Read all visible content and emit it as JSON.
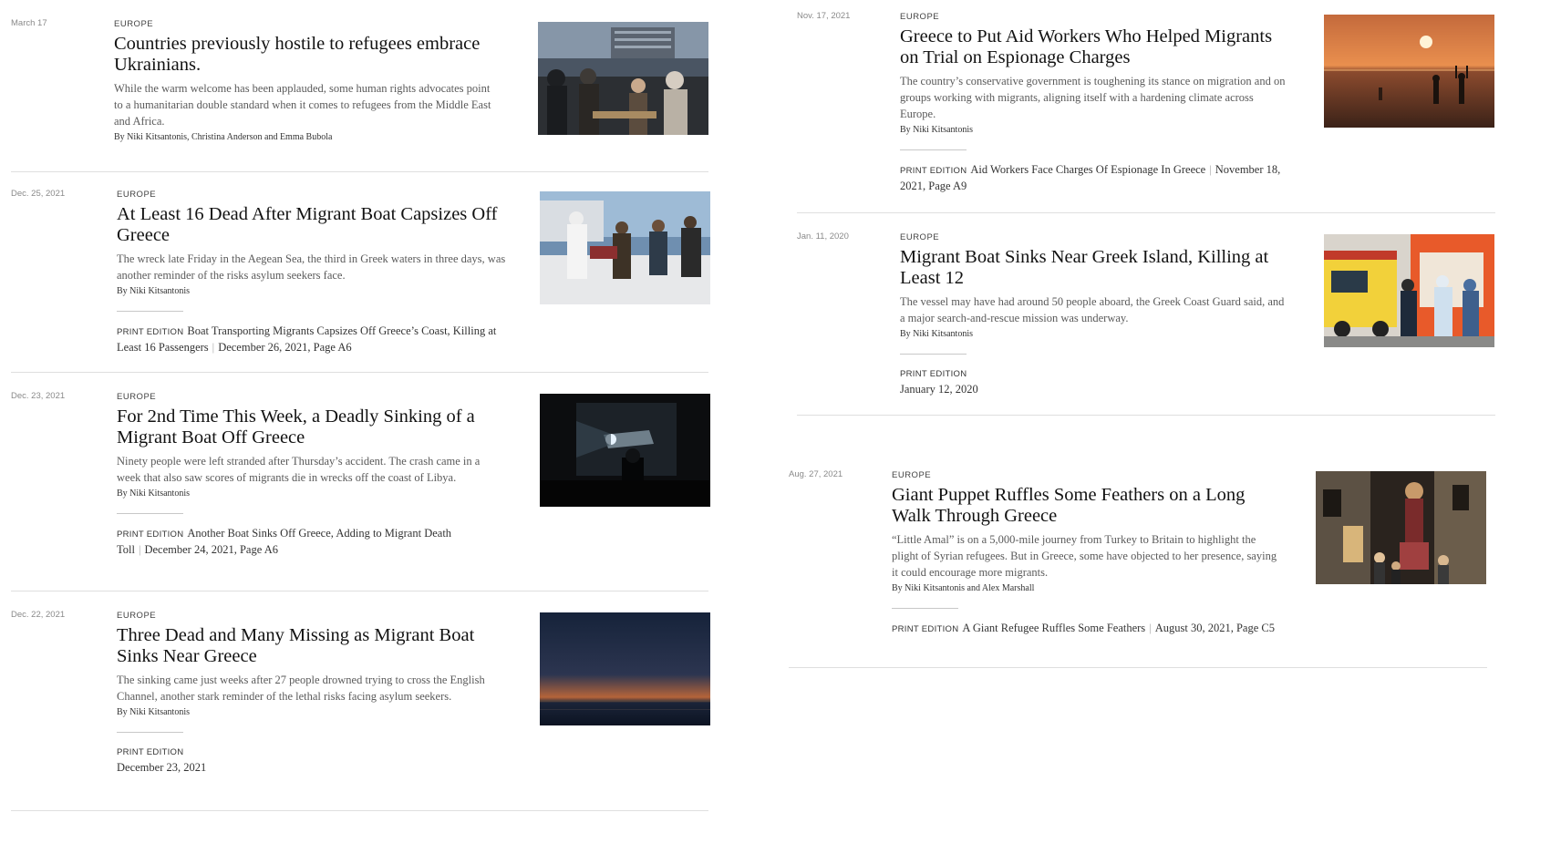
{
  "articles": [
    {
      "date": "March 17",
      "section": "Europe",
      "headline": "Countries previously hostile to refugees embrace Ukrainians.",
      "summary": "While the warm welcome has been applauded, some human rights advocates point to a humanitarian double standard when it comes to refugees from the Middle East and Africa.",
      "byline": "By Niki Kitsantonis, Christina Anderson and Emma Bubola",
      "image_icon": "photo-refugees-crowd-icon"
    },
    {
      "date": "Dec. 25, 2021",
      "section": "Europe",
      "headline": "At Least 16 Dead After Migrant Boat Capsizes Off Greece",
      "summary": "The wreck late Friday in the Aegean Sea, the third in Greek waters in three days, was another reminder of the risks asylum seekers face.",
      "byline": "By Niki Kitsantonis",
      "print_label": "Print Edition",
      "print_title": "Boat Transporting Migrants Capsizes Off Greece’s Coast, Killing at Least 16 Passengers",
      "print_date": "December 26, 2021, Page A6",
      "image_icon": "photo-rescue-boat-icon"
    },
    {
      "date": "Dec. 23, 2021",
      "section": "Europe",
      "headline": "For 2nd Time This Week, a Deadly Sinking of a Migrant Boat Off Greece",
      "summary": "Ninety people were left stranded after Thursday’s accident. The crash came in a week that also saw scores of migrants die in wrecks off the coast of Libya.",
      "byline": "By Niki Kitsantonis",
      "print_label": "Print Edition",
      "print_title": "Another Boat Sinks Off Greece, Adding to Migrant Death Toll",
      "print_date": "December 24, 2021, Page A6",
      "image_icon": "photo-night-search-icon"
    },
    {
      "date": "Dec. 22, 2021",
      "section": "Europe",
      "headline": "Three Dead and Many Missing as Migrant Boat Sinks Near Greece",
      "summary": "The sinking came just weeks after 27 people drowned trying to cross the English Channel, another stark reminder of the lethal risks facing asylum seekers.",
      "byline": "By Niki Kitsantonis",
      "print_label": "Print Edition",
      "print_date": "December 23, 2021",
      "image_icon": "photo-sea-dusk-icon"
    },
    {
      "date": "Nov. 17, 2021",
      "section": "Europe",
      "headline": "Greece to Put Aid Workers Who Helped Migrants on Trial on Espionage Charges",
      "summary": "The country’s conservative government is toughening its stance on migration and on groups working with migrants, aligning itself with a hardening climate across Europe.",
      "byline": "By Niki Kitsantonis",
      "print_label": "Print Edition",
      "print_title": "Aid Workers Face Charges Of Espionage In Greece",
      "print_date": "November 18, 2021, Page A9",
      "image_icon": "photo-sunset-sea-icon"
    },
    {
      "date": "Jan. 11, 2020",
      "section": "Europe",
      "headline": "Migrant Boat Sinks Near Greek Island, Killing at Least 12",
      "summary": "The vessel may have had around 50 people aboard, the Greek Coast Guard said, and a major search-and-rescue mission was underway.",
      "byline": "By Niki Kitsantonis",
      "print_label": "Print Edition",
      "print_date": "January 12, 2020",
      "image_icon": "photo-ambulance-icon"
    },
    {
      "date": "Aug. 27, 2021",
      "section": "Europe",
      "headline": "Giant Puppet Ruffles Some Feathers on a Long Walk Through Greece",
      "summary": "“Little Amal” is on a 5,000-mile journey from Turkey to Britain to highlight the plight of Syrian refugees. But in Greece, some have objected to her presence, saying it could encourage more migrants.",
      "byline": "By Niki Kitsantonis and Alex Marshall",
      "print_label": "Print Edition",
      "print_title": "A Giant Refugee Ruffles Some Feathers",
      "print_date": "August 30, 2021, Page C5",
      "image_icon": "photo-giant-puppet-icon"
    }
  ]
}
